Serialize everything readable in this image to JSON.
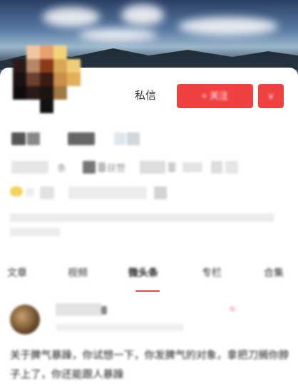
{
  "profile": {
    "dm_label": "私信",
    "follow_label": "+ 关注",
    "more_label": "∨",
    "stats": [
      {
        "label": "条"
      },
      {
        "label": "获赞"
      }
    ]
  },
  "tabs": [
    {
      "label": "文章"
    },
    {
      "label": "视频"
    },
    {
      "label": "微头条"
    },
    {
      "label": "专栏"
    },
    {
      "label": "合集"
    }
  ],
  "post": {
    "text": "关于脾气暴躁，你试想一下，你发脾气的对象，拿把刀搁你脖子上了，你还能跟人暴躁"
  },
  "colors": {
    "accent": "#f04142"
  }
}
